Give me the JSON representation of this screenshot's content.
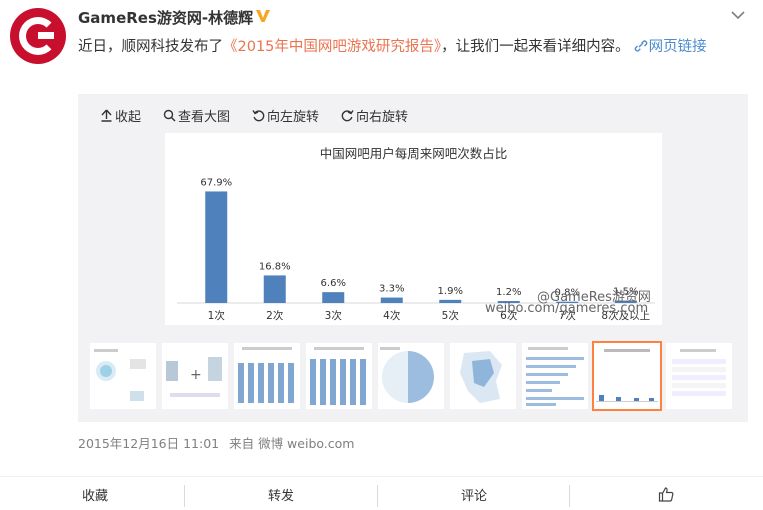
{
  "post": {
    "author": "GameRes游资网-林德辉",
    "text_before": "近日，顺网科技发布了",
    "link_text": "《2015年中国网吧游戏研究报告》",
    "text_after": "，让我们一起来看详细内容。",
    "web_link": "网页链接",
    "timestamp": "2015年12月16日 11:01",
    "source": "来自 微博 weibo.com"
  },
  "toolbar": {
    "collapse": "收起",
    "view_large": "查看大图",
    "rotate_left": "向左旋转",
    "rotate_right": "向右旋转"
  },
  "chart_data": {
    "type": "bar",
    "title": "中国网吧用户每周来网吧次数占比",
    "categories": [
      "1次",
      "2次",
      "3次",
      "4次",
      "5次",
      "6次",
      "7次",
      "8次及以上"
    ],
    "values": [
      67.9,
      16.8,
      6.6,
      3.3,
      1.9,
      1.2,
      0.8,
      1.5
    ],
    "labels": [
      "67.9%",
      "16.8%",
      "6.6%",
      "3.3%",
      "1.9%",
      "1.2%",
      "0.8%",
      "1.5%"
    ],
    "ylim": [
      0,
      70
    ],
    "bar_color": "#4f81bd",
    "grid": false
  },
  "watermark": {
    "line1": "@GameRes游资网",
    "line2": "weibo.com/gameres.com"
  },
  "thumbnails": [
    "thumb-1",
    "thumb-2",
    "thumb-3",
    "thumb-4",
    "thumb-5",
    "thumb-6",
    "thumb-7",
    "thumb-8",
    "thumb-9"
  ],
  "selected_thumbnail": 8,
  "actions": {
    "favorite": "收藏",
    "repost": "转发",
    "comment": "评论"
  },
  "colors": {
    "link": "#eb7350",
    "accent": "#ff8140",
    "verified": "#f5a623"
  }
}
